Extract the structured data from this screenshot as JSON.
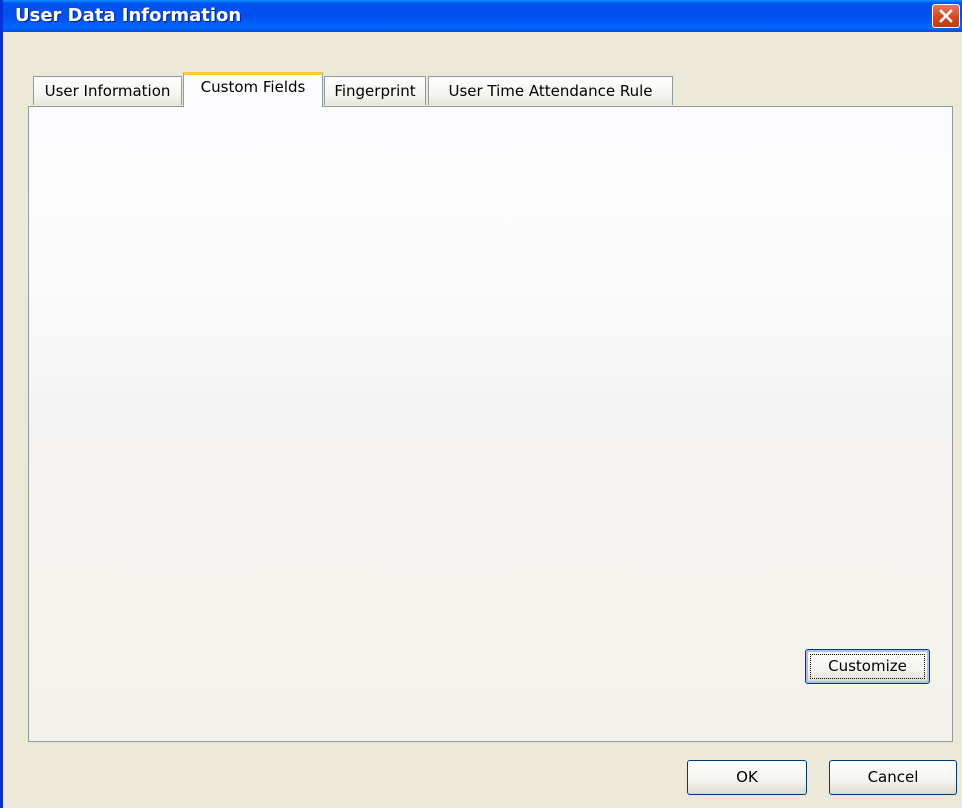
{
  "window": {
    "title": "User Data Information",
    "close_icon": "close-icon"
  },
  "tabs": [
    {
      "label": "User Information",
      "active": false
    },
    {
      "label": "Custom Fields",
      "active": true
    },
    {
      "label": "Fingerprint",
      "active": false
    },
    {
      "label": "User Time Attendance Rule",
      "active": false
    }
  ],
  "panel": {
    "customize_label": "Customize"
  },
  "footer": {
    "ok_label": "OK",
    "cancel_label": "Cancel"
  },
  "colors": {
    "title_bar": "#0053ee",
    "close_button": "#d6451f",
    "active_tab_accent": "#ffc83c",
    "dialog_background": "#ece9d8"
  }
}
